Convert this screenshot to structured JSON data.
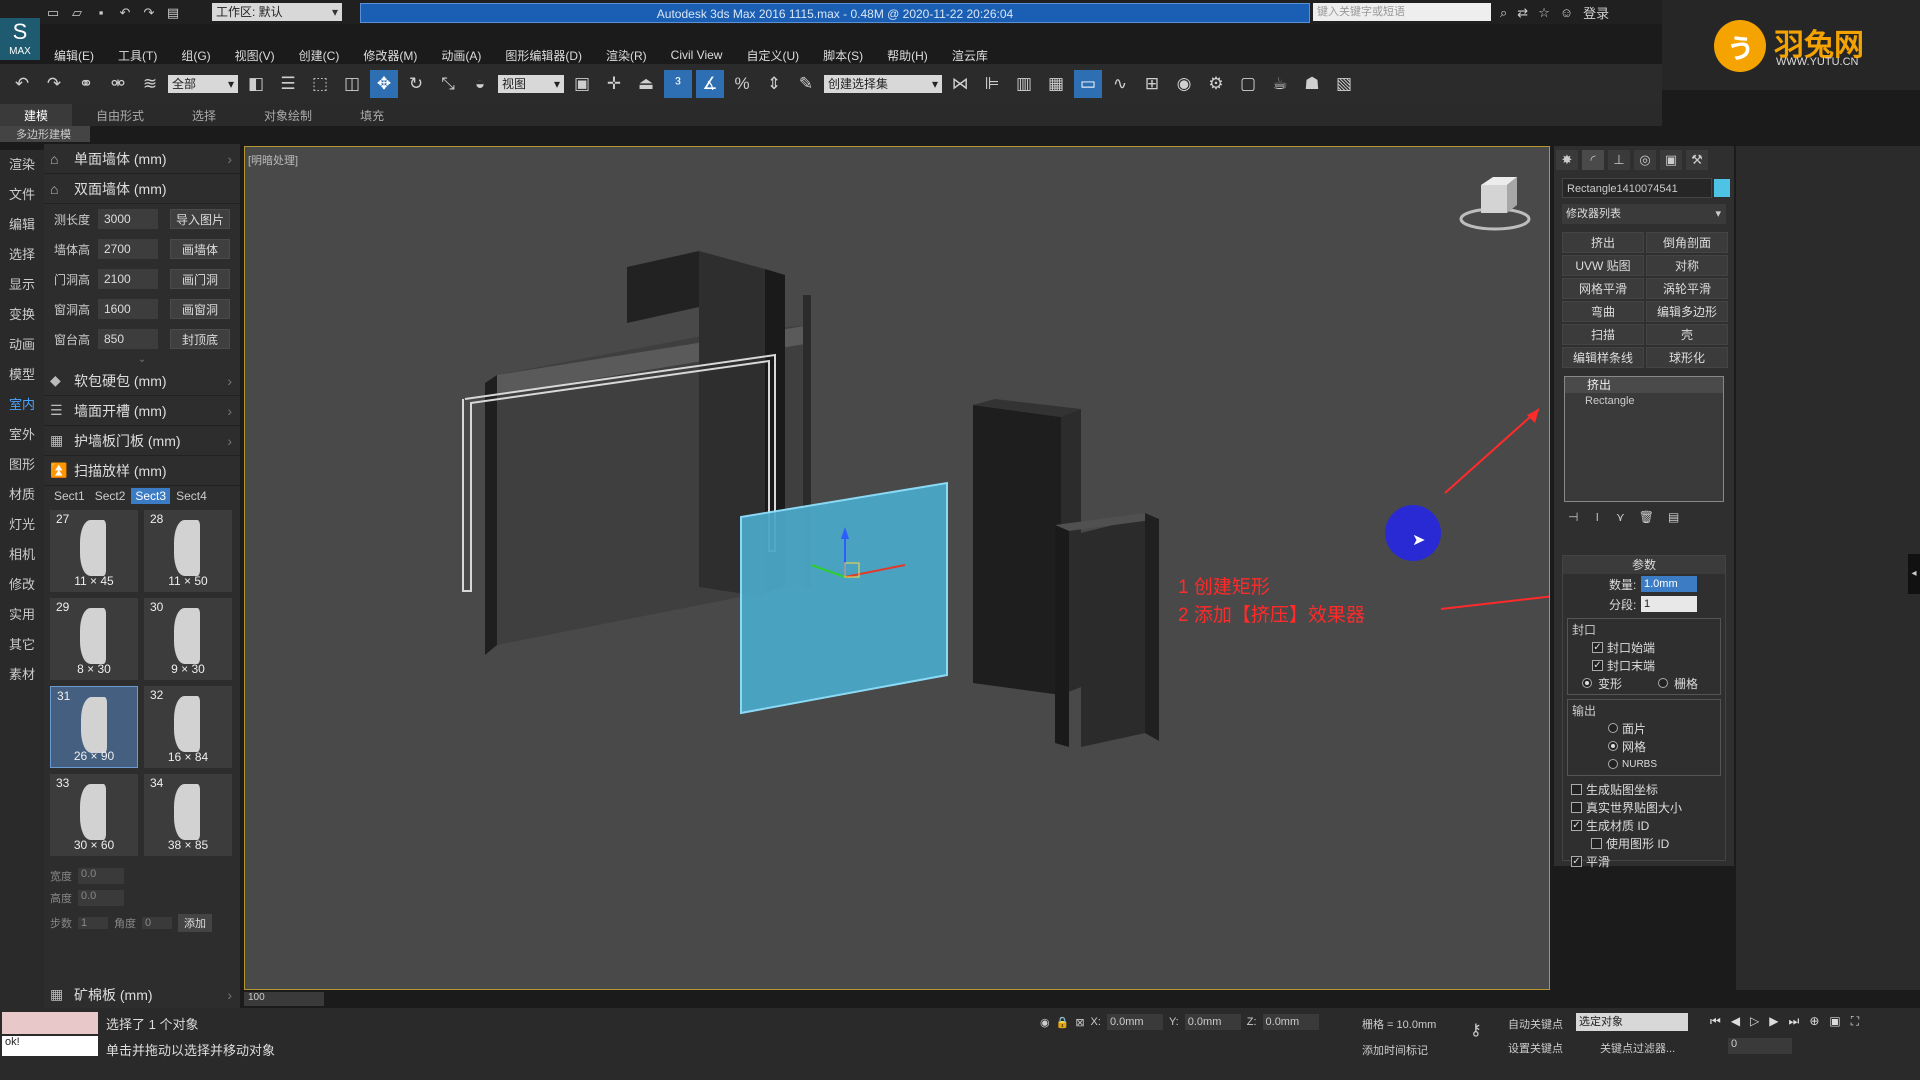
{
  "title_bar": {
    "title": "Autodesk 3ds Max 2016     1115.max - 0.48M @ 2020-11-22 20:26:04",
    "workspace": "工作区: 默认",
    "search_placeholder": "键入关键字或短语",
    "login": "登录"
  },
  "brand": {
    "name": "羽兔网",
    "url": "WWW.YUTU.CN"
  },
  "menu": [
    "编辑(E)",
    "工具(T)",
    "组(G)",
    "视图(V)",
    "创建(C)",
    "修改器(M)",
    "动画(A)",
    "图形编辑器(D)",
    "渲染(R)",
    "Civil View",
    "自定义(U)",
    "脚本(S)",
    "帮助(H)",
    "渲云库"
  ],
  "toolbar": {
    "filter": "全部",
    "view": "视图",
    "selection_set": "创建选择集"
  },
  "ribbon": {
    "tabs": [
      "建模",
      "自由形式",
      "选择",
      "对象绘制",
      "填充"
    ],
    "sub": "多边形建模"
  },
  "left_icons": [
    "渲染",
    "文件",
    "编辑",
    "选择",
    "显示",
    "变换",
    "动画",
    "模型",
    "室内",
    "室外",
    "图形",
    "材质",
    "灯光",
    "相机",
    "修改",
    "实用",
    "其它",
    "素材"
  ],
  "left_panel": {
    "sections": [
      "单面墙体 (mm)",
      "双面墙体 (mm)",
      "软包硬包 (mm)",
      "墙面开槽 (mm)",
      "护墙板门板 (mm)",
      "扫描放样 (mm)",
      "矿棉板 (mm)"
    ],
    "rows": [
      {
        "label": "测长度",
        "value": "3000",
        "btn": "导入图片"
      },
      {
        "label": "墙体高",
        "value": "2700",
        "btn": "画墙体"
      },
      {
        "label": "门洞高",
        "value": "2100",
        "btn": "画门洞"
      },
      {
        "label": "窗洞高",
        "value": "1600",
        "btn": "画窗洞"
      },
      {
        "label": "窗台高",
        "value": "850",
        "btn": "封顶底"
      }
    ],
    "tabs": [
      "Sect1",
      "Sect2",
      "Sect3",
      "Sect4"
    ],
    "cells": [
      {
        "n": "27",
        "d": "11 × 45"
      },
      {
        "n": "28",
        "d": "11 × 50"
      },
      {
        "n": "29",
        "d": "8 × 30"
      },
      {
        "n": "30",
        "d": "9 × 30"
      },
      {
        "n": "31",
        "d": "26 × 90"
      },
      {
        "n": "32",
        "d": "16 × 84"
      },
      {
        "n": "33",
        "d": "30 × 60"
      },
      {
        "n": "34",
        "d": "38 × 85"
      }
    ],
    "bottom_fields": {
      "width": "宽度",
      "width_val": "0.0",
      "height": "高度",
      "height_val": "0.0",
      "steps": "步数",
      "steps_val": "1",
      "angle": "角度",
      "angle_val": "0",
      "add": "添加"
    }
  },
  "viewport": {
    "label": "[明暗处理]",
    "annotation_1": "1 创建矩形",
    "annotation_2": "2 添加【挤压】效果器"
  },
  "right_panel": {
    "object_name": "Rectangle1410074541",
    "modifier_list": "修改器列表",
    "mod_buttons": [
      "挤出",
      "倒角剖面",
      "UVW 贴图",
      "对称",
      "网格平滑",
      "涡轮平滑",
      "弯曲",
      "编辑多边形",
      "扫描",
      "壳",
      "编辑样条线",
      "球形化"
    ],
    "stack": [
      "挤出",
      "Rectangle"
    ],
    "params_title": "参数",
    "amount_label": "数量:",
    "amount": "1.0mm",
    "segments_label": "分段:",
    "segments": "1",
    "cap_title": "封口",
    "cap_start": "封口始端",
    "cap_end": "封口末端",
    "morph": "变形",
    "grid": "栅格",
    "output_title": "输出",
    "patch": "面片",
    "mesh": "网格",
    "nurbs": "NURBS",
    "gen_map": "生成贴图坐标",
    "real_world": "真实世界贴图大小",
    "gen_mat": "生成材质 ID",
    "use_shape": "使用图形 ID",
    "smooth": "平滑"
  },
  "status": {
    "selected": "选择了 1 个对象",
    "hint": "单击并拖动以选择并移动对象",
    "ok": "ok!",
    "x": "0.0mm",
    "y": "0.0mm",
    "z": "0.0mm",
    "grid": "栅格 = 10.0mm",
    "auto_key": "自动关键点",
    "set_key": "设置关键点",
    "sel_obj": "选定对象",
    "key_filter": "关键点过滤器...",
    "add_time": "添加时间标记",
    "frame": "0",
    "timeline": "100"
  }
}
